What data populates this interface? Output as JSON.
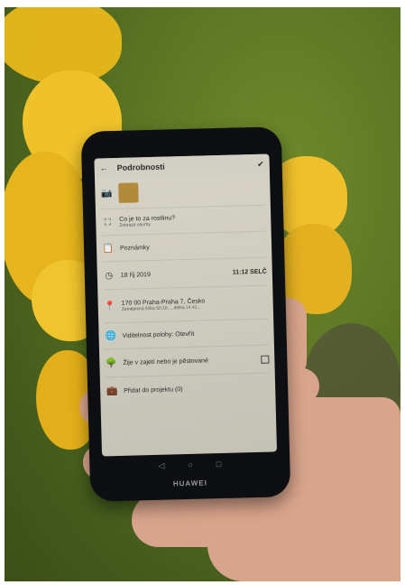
{
  "phone": {
    "brand": "HUAWEI",
    "app": {
      "title": "Podrobnosti",
      "rows": [
        {
          "icon": "camera-icon",
          "glyph": "📷",
          "label": "",
          "sub": ""
        },
        {
          "icon": "scan-icon",
          "glyph": "⛶",
          "label": "Co je to za rostlinu?",
          "sub": "Zobrazit návrhy"
        },
        {
          "icon": "clipboard-icon",
          "glyph": "📋",
          "label": "Poznámky",
          "sub": ""
        },
        {
          "icon": "clock-icon",
          "glyph": "◷",
          "label": "18 říj 2019",
          "sub": "",
          "right": "11:12 SELČ"
        },
        {
          "icon": "location-icon",
          "glyph": "📍",
          "label": "170 00 Praha-Praha 7, Česko",
          "sub": "Zeměpisná šířka 50.10..., délka 14.41..."
        },
        {
          "icon": "globe-icon",
          "glyph": "🌐",
          "label": "Viditelnost polohy: Otevřít",
          "sub": ""
        },
        {
          "icon": "tree-icon",
          "glyph": "🌳",
          "label": "Žije v zajetí nebo je pěstované",
          "sub": ""
        },
        {
          "icon": "briefcase-icon",
          "glyph": "💼",
          "label": "Přidat do projektu (0)",
          "sub": ""
        }
      ]
    }
  }
}
